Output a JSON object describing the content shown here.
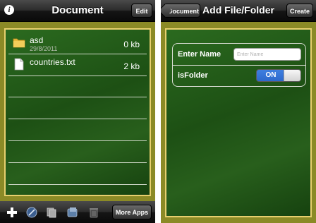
{
  "document_screen": {
    "nav": {
      "title": "Document",
      "edit_label": "Edit"
    },
    "files": [
      {
        "name": "asd",
        "date": "29/8/2011",
        "size": "0 kb",
        "icon": "folder-icon"
      },
      {
        "name": "countries.txt",
        "date": "",
        "size": "2 kb",
        "icon": "document-icon"
      }
    ],
    "toolbar": {
      "more_apps_label": "More Apps"
    }
  },
  "add_screen": {
    "nav": {
      "title": "Add File/Folder",
      "back_label": "Document",
      "create_label": "Create"
    },
    "form": {
      "name_label": "Enter Name",
      "name_placeholder": "Enter Name",
      "is_folder_label": "isFolder",
      "toggle_label": "ON"
    }
  },
  "colors": {
    "board": "#1f4f17",
    "frame": "#8b8a26",
    "border": "#e7cf6e",
    "toggle_on": "#3f7fe0"
  }
}
